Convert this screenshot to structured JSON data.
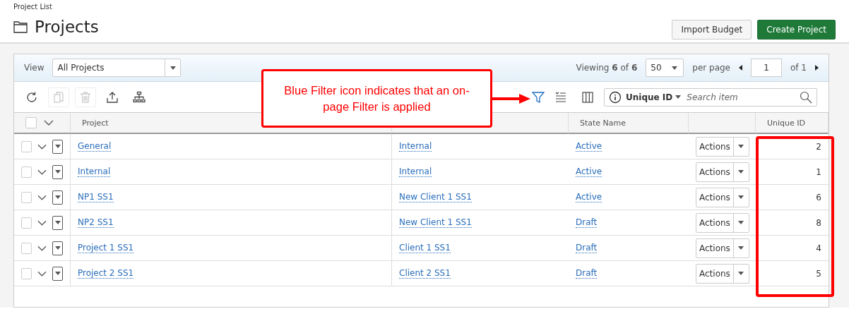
{
  "breadcrumb": "Project List",
  "page_title": "Projects",
  "header_buttons": [
    {
      "label": "Import Budget",
      "kind": "secondary"
    },
    {
      "label": "Create Project",
      "kind": "primary"
    }
  ],
  "view_bar": {
    "label": "View",
    "view": "All Projects",
    "viewing_label": "Viewing",
    "viewing_count": "6",
    "viewing_of": "of",
    "viewing_total": "6",
    "per_page_value": "50",
    "per_page_label": "per page",
    "page": "1",
    "page_of": "of 1"
  },
  "toolbar": {
    "tools": [
      {
        "kind": "refresh",
        "disabled": false
      },
      {
        "kind": "copy",
        "disabled": true
      },
      {
        "kind": "delete",
        "disabled": true
      },
      {
        "kind": "export",
        "disabled": false
      },
      {
        "kind": "hierarchy",
        "disabled": false
      }
    ],
    "filter_applied": true,
    "search_field": "Unique ID",
    "search_placeholder": "Search item"
  },
  "table": {
    "select_all_checked": false,
    "columns": [
      {
        "kind": "project",
        "label": "Project"
      },
      {
        "kind": "client"
      },
      {
        "kind": "state",
        "label": "State Name"
      },
      {
        "kind": "actions"
      },
      {
        "kind": "unique_id",
        "label": "Unique ID"
      }
    ],
    "rows": [
      {
        "checked": false,
        "project": "General",
        "client": "Internal",
        "state": "Active",
        "action": "Actions",
        "unique_id": "2"
      },
      {
        "checked": false,
        "project": "Internal",
        "client": "Internal",
        "state": "Active",
        "action": "Actions",
        "unique_id": "1"
      },
      {
        "checked": false,
        "project": "NP1 SS1",
        "client": "New Client 1 SS1",
        "state": "Active",
        "action": "Actions",
        "unique_id": "6"
      },
      {
        "checked": false,
        "project": "NP2 SS1",
        "client": "New Client 1 SS1",
        "state": "Draft",
        "action": "Actions",
        "unique_id": "8"
      },
      {
        "checked": false,
        "project": "Project 1 SS1",
        "client": "Client 1 SS1",
        "state": "Draft",
        "action": "Actions",
        "unique_id": "4"
      },
      {
        "checked": false,
        "project": "Project 2 SS1",
        "client": "Client 2 SS1",
        "state": "Draft",
        "action": "Actions",
        "unique_id": "5"
      }
    ]
  },
  "callout": {
    "text": "Blue Filter icon indicates that an on-page Filter is applied"
  }
}
